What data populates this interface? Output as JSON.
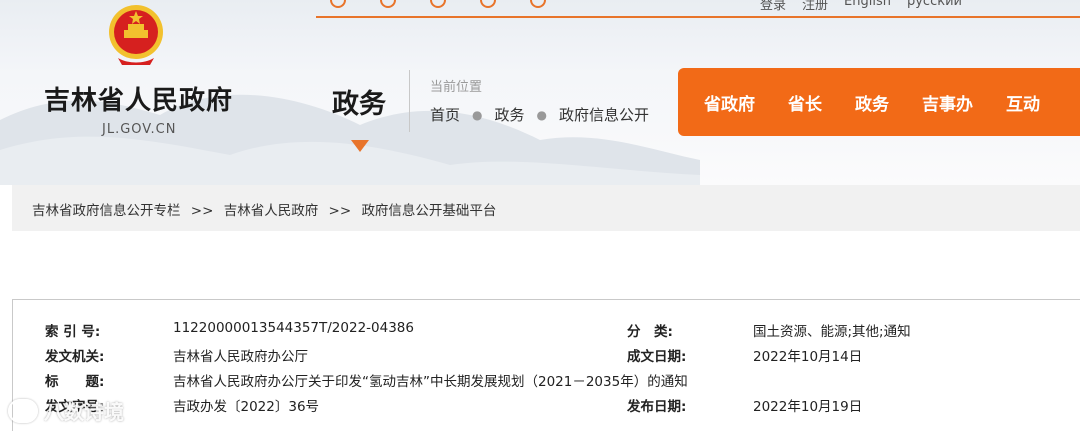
{
  "header": {
    "site_title": "吉林省人民政府",
    "site_domain": "JL.GOV.CN",
    "section_title": "政务",
    "top_links": [
      "登录",
      "注册",
      "English",
      "русский"
    ],
    "location_label": "当前位置",
    "location_path": [
      "首页",
      "政务",
      "政府信息公开"
    ],
    "nav": [
      "省政府",
      "省长",
      "政务",
      "吉事办",
      "互动"
    ]
  },
  "breadcrumb": {
    "items": [
      "吉林省政府信息公开专栏",
      "吉林省人民政府",
      "政府信息公开基础平台"
    ],
    "separator": ">>"
  },
  "meta": {
    "index_label": "索 引 号:",
    "index_value": "11220000013544357T/2022-04386",
    "category_label": "分　类:",
    "category_value": "国土资源、能源;其他;通知",
    "issuer_label": "发文机关:",
    "issuer_value": "吉林省人民政府办公厅",
    "written_label": "成文日期:",
    "written_value": "2022年10月14日",
    "title_label": "标　　题:",
    "title_value": "吉林省人民政府办公厅关于印发“氢动吉林”中长期发展规划（2021－2035年）的通知",
    "docno_label": "发文字号:",
    "docno_value": "吉政办发〔2022〕36号",
    "published_label": "发布日期:",
    "published_value": "2022年10月19日"
  },
  "watermark": {
    "text": "八数诗境"
  },
  "colors": {
    "accent": "#f26a17",
    "emblem_red": "#d6201f",
    "emblem_gold": "#f2c12e"
  }
}
